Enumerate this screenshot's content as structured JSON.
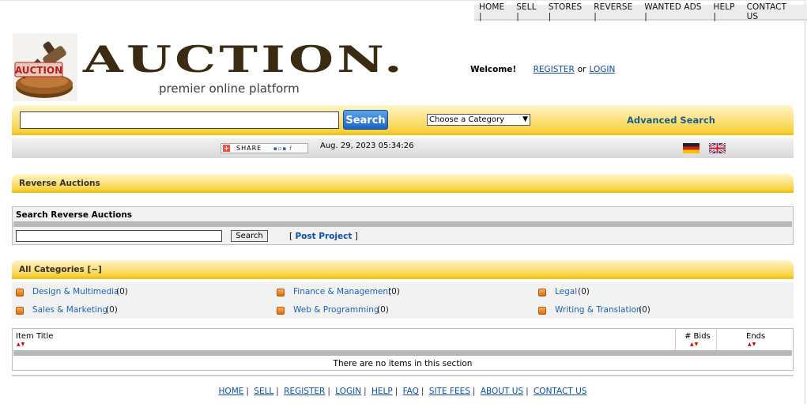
{
  "topnav": [
    "HOME |",
    "SELL |",
    "STORES |",
    "REVERSE |",
    "WANTED ADS |",
    "HELP |",
    "CONTACT US"
  ],
  "logo": {
    "badge_text": "AUCTION",
    "wordmark": "AUCTION.",
    "tagline": "premier online platform"
  },
  "header": {
    "welcome": "Welcome!",
    "register": "REGISTER",
    "or": "or",
    "login": "LOGIN"
  },
  "search": {
    "button": "Search",
    "category_default": "Choose a Category",
    "advanced": "Advanced Search",
    "value": ""
  },
  "toolbar": {
    "share": "SHARE",
    "datetime": "Aug. 29, 2023 05:34:26"
  },
  "reverse_bar": {
    "title": "Reverse Auctions"
  },
  "search_reverse": {
    "title": "Search Reverse Auctions",
    "button": "Search",
    "post_prefix": "[",
    "post": "Post Project",
    "post_suffix": "]"
  },
  "categories": {
    "title": "All Categories [−]",
    "items": [
      {
        "name": "Design & Multimedia",
        "count": "(0)"
      },
      {
        "name": "Finance & Management",
        "count": "(0)"
      },
      {
        "name": "Legal",
        "count": "(0)"
      },
      {
        "name": "Sales & Marketing",
        "count": "(0)"
      },
      {
        "name": "Web & Programming",
        "count": "(0)"
      },
      {
        "name": "Writing & Translation",
        "count": "(0)"
      }
    ]
  },
  "items_table": {
    "headers": [
      "Item Title",
      "# Bids",
      "Ends"
    ],
    "sort_glyph": "▲▼",
    "empty": "There are no items in this section"
  },
  "footer": [
    "HOME",
    "SELL",
    "REGISTER",
    "LOGIN",
    "HELP",
    "FAQ",
    "SITE FEES",
    "ABOUT US",
    "CONTACT US"
  ],
  "colors": {
    "accent_yellow": "#f6cf38",
    "link": "#0d4ea6",
    "search_button": "#1c63c2"
  }
}
